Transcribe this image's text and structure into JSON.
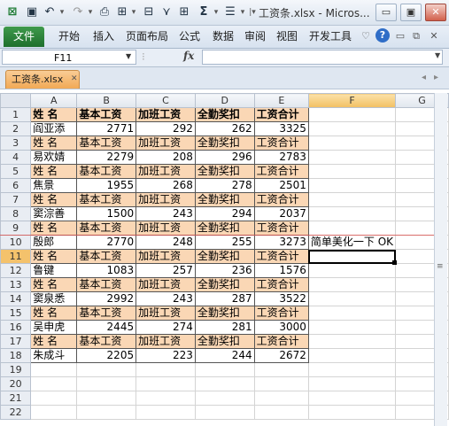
{
  "title_bar": {
    "title": "工资条.xlsx - Micros...",
    "qa_icons": [
      "excel-logo-icon",
      "save-icon",
      "undo-icon",
      "redo-icon",
      "print-preview-icon",
      "table-icon",
      "filter-icon",
      "borders-icon",
      "autosum-icon",
      "wrap-text-icon",
      "customize-icon"
    ],
    "window_buttons": {
      "minimize": "▭",
      "restore": "▣",
      "close": "✕"
    }
  },
  "ribbon": {
    "file": "文件",
    "tabs": [
      "开始",
      "插入",
      "页面布局",
      "公式",
      "数据",
      "审阅",
      "视图",
      "开发工具"
    ]
  },
  "formula_bar": {
    "name_box": "F11",
    "fx": "fx",
    "value": ""
  },
  "workbook_tab": {
    "name": "工资条.xlsx"
  },
  "columns": [
    "A",
    "B",
    "C",
    "D",
    "E",
    "F",
    "G"
  ],
  "selected_col": "F",
  "selected_row": "11",
  "rows": [
    {
      "n": "1",
      "type": "header",
      "cells": [
        "姓 名",
        "基本工资",
        "加班工资",
        "全勤奖扣",
        "工资合计"
      ]
    },
    {
      "n": "2",
      "type": "data",
      "cells": [
        "阎亚添",
        "2771",
        "292",
        "262",
        "3325"
      ]
    },
    {
      "n": "3",
      "type": "header",
      "cells": [
        "姓 名",
        "基本工资",
        "加班工资",
        "全勤奖扣",
        "工资合计"
      ]
    },
    {
      "n": "4",
      "type": "data",
      "cells": [
        "易欢婧",
        "2279",
        "208",
        "296",
        "2783"
      ]
    },
    {
      "n": "5",
      "type": "header",
      "cells": [
        "姓 名",
        "基本工资",
        "加班工资",
        "全勤奖扣",
        "工资合计"
      ]
    },
    {
      "n": "6",
      "type": "data",
      "cells": [
        "焦景",
        "1955",
        "268",
        "278",
        "2501"
      ]
    },
    {
      "n": "7",
      "type": "header",
      "cells": [
        "姓 名",
        "基本工资",
        "加班工资",
        "全勤奖扣",
        "工资合计"
      ]
    },
    {
      "n": "8",
      "type": "data",
      "cells": [
        "窦淙善",
        "1500",
        "243",
        "294",
        "2037"
      ]
    },
    {
      "n": "9",
      "type": "header",
      "cells": [
        "姓 名",
        "基本工资",
        "加班工资",
        "全勤奖扣",
        "工资合计"
      ]
    },
    {
      "n": "10",
      "type": "data",
      "cells": [
        "殷郎",
        "2770",
        "248",
        "255",
        "3273"
      ],
      "note": "简单美化一下 OK"
    },
    {
      "n": "11",
      "type": "header",
      "cells": [
        "姓 名",
        "基本工资",
        "加班工资",
        "全勤奖扣",
        "工资合计"
      ]
    },
    {
      "n": "12",
      "type": "data",
      "cells": [
        "鲁键",
        "1083",
        "257",
        "236",
        "1576"
      ]
    },
    {
      "n": "13",
      "type": "header",
      "cells": [
        "姓 名",
        "基本工资",
        "加班工资",
        "全勤奖扣",
        "工资合计"
      ]
    },
    {
      "n": "14",
      "type": "data",
      "cells": [
        "窦泉悉",
        "2992",
        "243",
        "287",
        "3522"
      ]
    },
    {
      "n": "15",
      "type": "header",
      "cells": [
        "姓 名",
        "基本工资",
        "加班工资",
        "全勤奖扣",
        "工资合计"
      ]
    },
    {
      "n": "16",
      "type": "data",
      "cells": [
        "吴申虎",
        "2445",
        "274",
        "281",
        "3000"
      ]
    },
    {
      "n": "17",
      "type": "header",
      "cells": [
        "姓 名",
        "基本工资",
        "加班工资",
        "全勤奖扣",
        "工资合计"
      ]
    },
    {
      "n": "18",
      "type": "data",
      "cells": [
        "朱成斗",
        "2205",
        "223",
        "244",
        "2672"
      ]
    },
    {
      "n": "19",
      "type": "empty",
      "cells": []
    },
    {
      "n": "20",
      "type": "empty",
      "cells": []
    },
    {
      "n": "21",
      "type": "empty",
      "cells": []
    },
    {
      "n": "22",
      "type": "empty",
      "cells": []
    }
  ],
  "colors": {
    "header_fill": "#fad7b5",
    "file_tab": "#2a7d37",
    "workbook_tab": "#f4b464",
    "split_line": "#d9534f"
  }
}
